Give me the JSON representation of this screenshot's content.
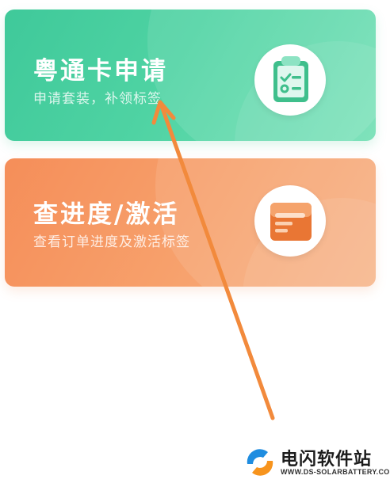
{
  "cards": [
    {
      "title": "粤通卡申请",
      "subtitle": "申请套装，补领标签",
      "icon": "clipboard-checklist-icon",
      "color": "#4fd3a3"
    },
    {
      "title": "查进度/激活",
      "subtitle": "查看订单进度及激活标签",
      "icon": "document-card-icon",
      "color": "#f7a06b"
    }
  ],
  "annotation": {
    "type": "arrow",
    "color": "#f28a3c"
  },
  "watermark": {
    "name": "电闪软件站",
    "domain": "WWW.DS-SOLARBATTERY.COM"
  }
}
